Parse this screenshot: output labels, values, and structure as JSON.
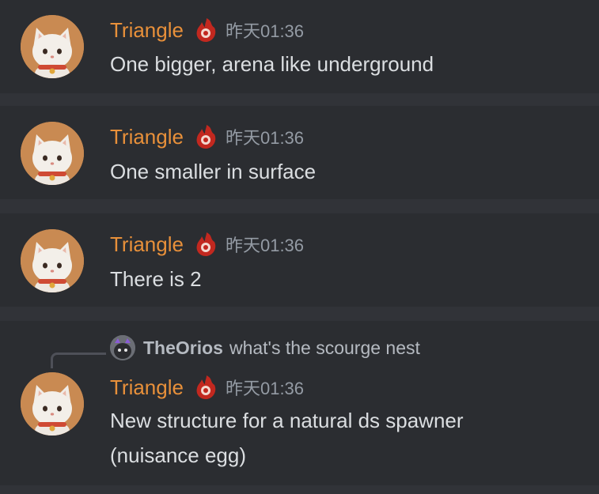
{
  "colors": {
    "background": "#313338",
    "message_bg": "#2b2d31",
    "username": "#e8903a",
    "timestamp": "#949ba4",
    "text": "#dbdee1",
    "reply_text": "#b5bac1"
  },
  "messages": [
    {
      "author": "Triangle",
      "role_icon": "flame-bomb-icon",
      "timestamp": "昨天01:36",
      "lines": [
        "One bigger, arena like underground"
      ]
    },
    {
      "author": "Triangle",
      "role_icon": "flame-bomb-icon",
      "timestamp": "昨天01:36",
      "lines": [
        "One smaller in surface"
      ]
    },
    {
      "author": "Triangle",
      "role_icon": "flame-bomb-icon",
      "timestamp": "昨天01:36",
      "lines": [
        "There is 2"
      ]
    },
    {
      "reply": {
        "author": "TheOrios",
        "text": "what's the scourge nest"
      },
      "author": "Triangle",
      "role_icon": "flame-bomb-icon",
      "timestamp": "昨天01:36",
      "lines": [
        "New structure for a natural ds spawner",
        "(nuisance egg)"
      ]
    }
  ]
}
